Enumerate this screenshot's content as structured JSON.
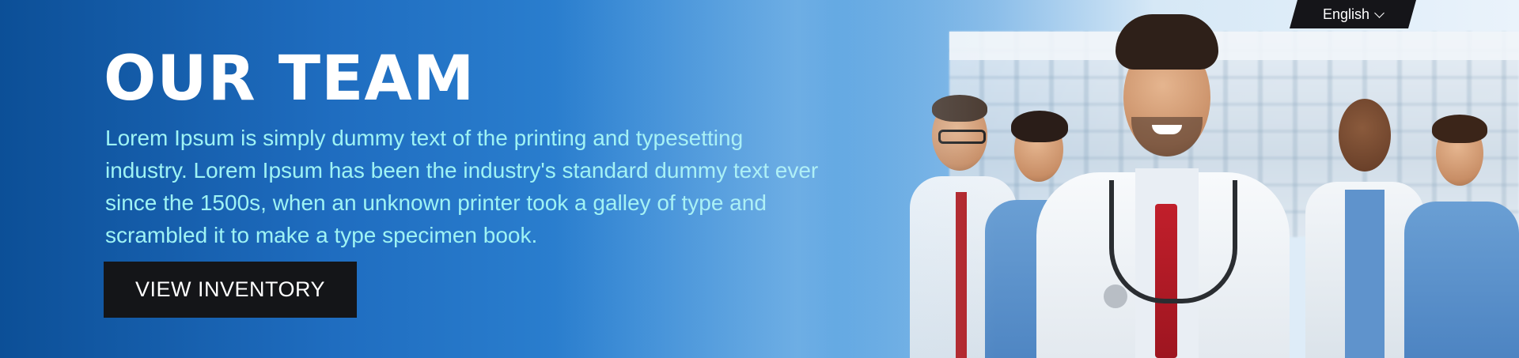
{
  "banner": {
    "title": "OUR TEAM",
    "description_lines": [
      "Lorem Ipsum is simply dummy text of the printing and typesetting",
      "industry. Lorem Ipsum has been the industry's standard dummy text ever",
      "since the 1500s, when an unknown printer took a galley of type and",
      "scrambled it to make a type specimen book."
    ],
    "cta_label": "VIEW INVENTORY"
  },
  "language": {
    "selected": "English",
    "icon": "chevron-down-icon"
  },
  "photo": {
    "subject": "team-photo"
  },
  "colors": {
    "title": "#ffffff",
    "description": "#9ef3f4",
    "cta_background": "#141518",
    "language_background": "#151519"
  }
}
